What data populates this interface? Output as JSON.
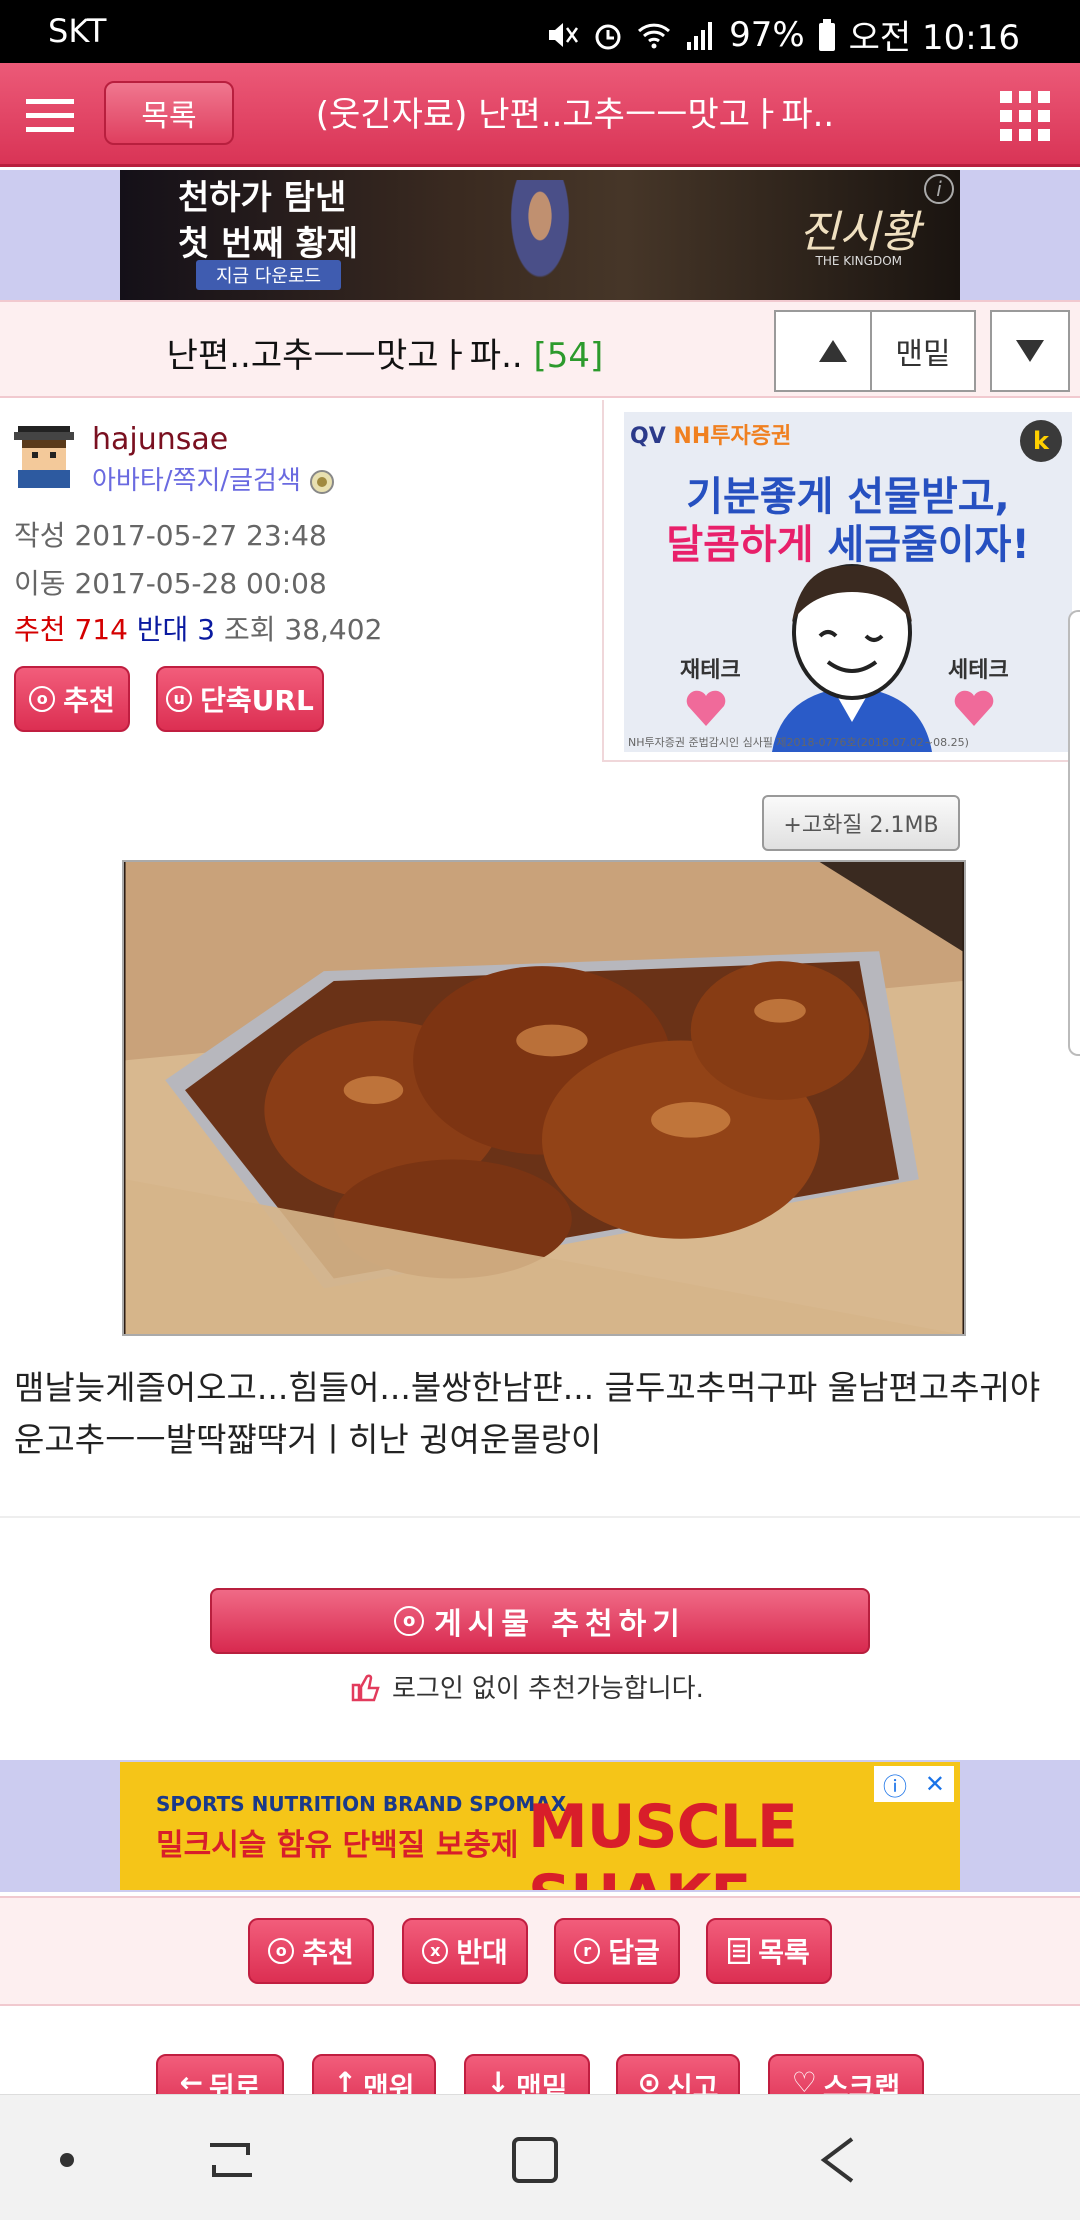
{
  "status_bar": {
    "carrier": "SKT",
    "battery": "97%",
    "time": "오전 10:16"
  },
  "header": {
    "list_button": "목록",
    "title": "(웃긴자료) 난편..고추ㅡㅡ맛고ㅏ파.."
  },
  "ad_top": {
    "line1": "천하가 탐낸",
    "line2": "첫 번째 황제",
    "button": "지금 다운로드",
    "brand": "진시황",
    "brand_sub": "THE KINGDOM"
  },
  "post": {
    "title": "난편..고추ㅡㅡ맛고ㅏ파..",
    "comment_count": "[54]",
    "nav_bottom_label": "맨밑"
  },
  "author": {
    "username": "hajunsae",
    "links": "아바타/쪽지/글검색",
    "created_label": "작성",
    "created": "2017-05-27 23:48",
    "moved_label": "이동",
    "moved": "2017-05-28 00:08",
    "recommend_label": "추천",
    "recommend": "714",
    "oppose_label": "반대",
    "oppose": "3",
    "views_label": "조회",
    "views": "38,402",
    "recommend_button": "추천",
    "shorturl_button": "단축URL"
  },
  "ad_side": {
    "logo1": "QV",
    "logo2": "NH투자증권",
    "line1": "기분좋게 선물받고,",
    "line2_pink": "달콤하게",
    "line2_rest": " 세금줄이자!",
    "tag_left": "재테크",
    "tag_right": "세테크",
    "footnote": "NH투자증권 준법감시인 심사필 제2018-0776호(2018.07.02~08.25)"
  },
  "content": {
    "hq_button": "+고화질 2.1MB",
    "body": "맴날늦게즐어오고...힘들어...불쌍한남퍈... 글두꼬추먹구파 울남편고추귀야운고추ㅡㅡ발딱쨟땩거ㅣ히난 귕여운몰랑이"
  },
  "recommend_section": {
    "button": "게시물 추천하기",
    "note": "로그인 없이 추천가능합니다."
  },
  "ad_bottom": {
    "line1": "SPORTS NUTRITION BRAND SPOMAX",
    "line2": "밀크시슬 함유 단백질 보충제",
    "big": "MUSCLE SHAKE"
  },
  "action_bar": {
    "recommend": "추천",
    "oppose": "반대",
    "reply": "답글",
    "list": "목록"
  },
  "nav_row": {
    "back": "뒤로",
    "top": "맨위",
    "bottom": "맨밑",
    "report": "신고",
    "scrap": "스크랩"
  },
  "colors": {
    "header": "#d93456",
    "accent_pink": "#dc2f52",
    "count_green": "#2c9a2c",
    "recommend_red": "#d40000",
    "oppose_blue": "#0a1aa0"
  }
}
